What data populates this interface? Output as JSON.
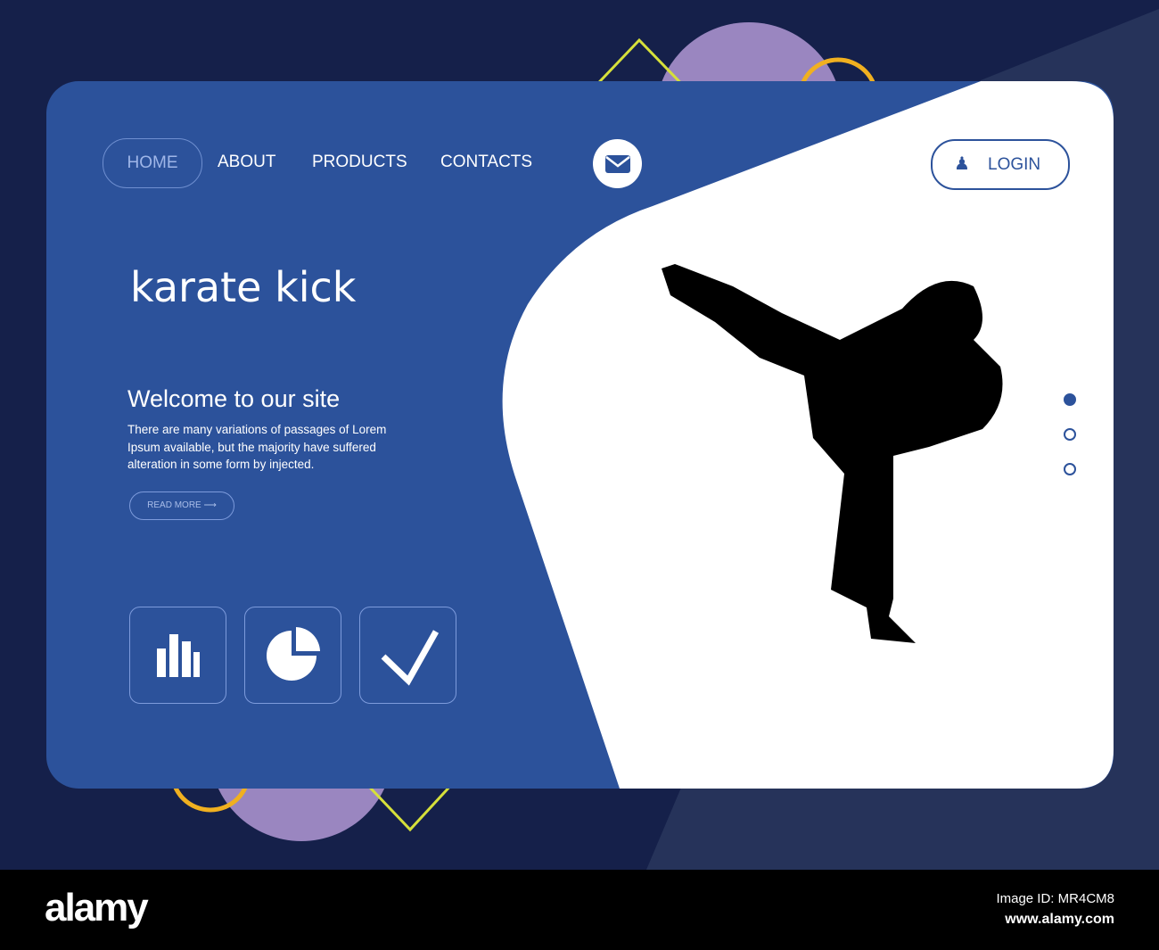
{
  "nav": {
    "items": [
      "HOME",
      "ABOUT",
      "PRODUCTS",
      "CONTACTS"
    ],
    "login": "LOGIN"
  },
  "hero": {
    "title": "karate kick",
    "welcome": "Welcome to our site",
    "body": "There are many variations of passages of Lorem Ipsum available, but the majority have suffered alteration in some form by injected.",
    "read_more": "READ MORE"
  },
  "footer": {
    "logo": "alamy",
    "image_id": "Image ID: MR4CM8",
    "url": "www.alamy.com"
  },
  "colors": {
    "primary": "#2c529b",
    "bg": "#15204a"
  }
}
